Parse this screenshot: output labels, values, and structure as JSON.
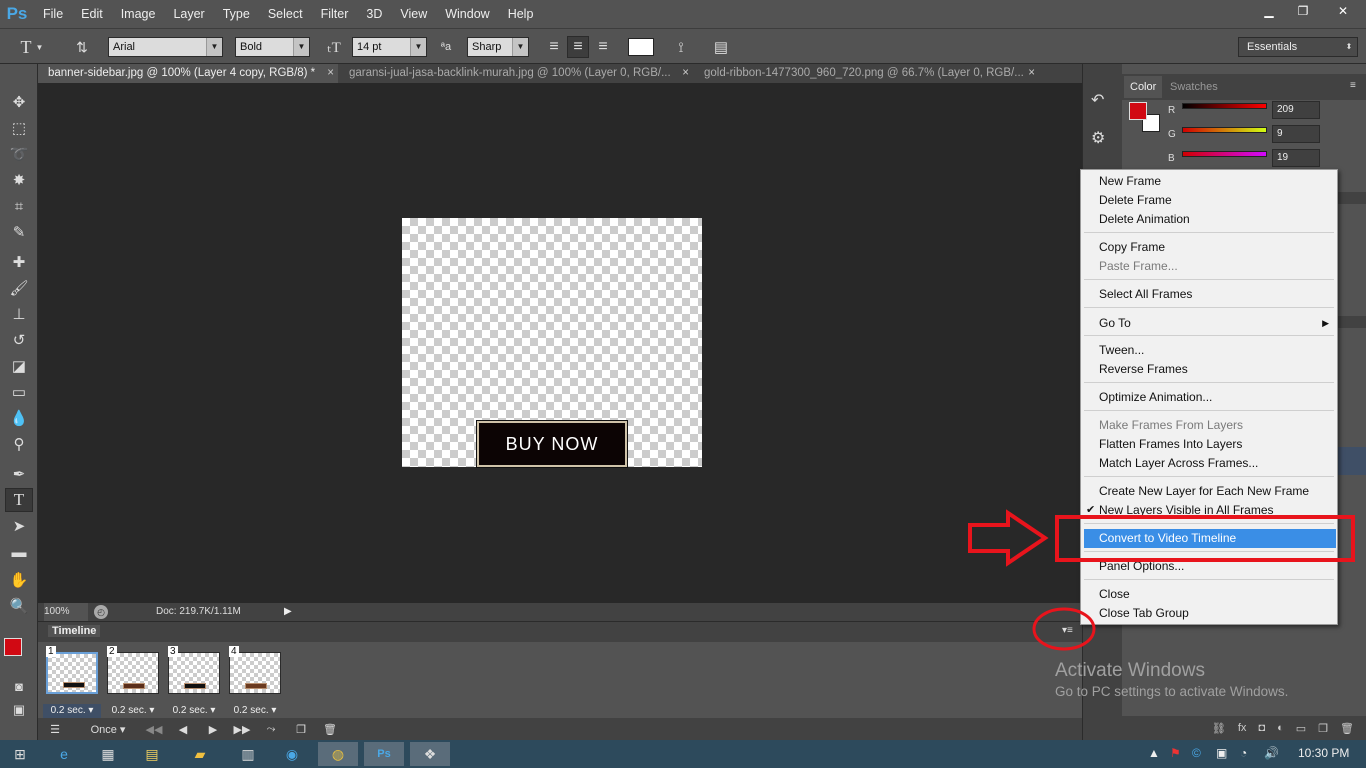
{
  "app": {
    "logo": "Ps"
  },
  "menubar": {
    "items": [
      "File",
      "Edit",
      "Image",
      "Layer",
      "Type",
      "Select",
      "Filter",
      "3D",
      "View",
      "Window",
      "Help"
    ]
  },
  "window_controls": {
    "minimize": "▁",
    "restore": "❐",
    "close": "✕"
  },
  "options_bar": {
    "font_family": "Arial",
    "font_style": "Bold",
    "font_size": "14 pt",
    "antialias": "Sharp",
    "workspace": "Essentials",
    "color_swatch": "#ffffff"
  },
  "document_tabs": [
    {
      "label": "banner-sidebar.jpg @ 100% (Layer 4 copy, RGB/8) *",
      "active": true
    },
    {
      "label": "garansi-jual-jasa-backlink-murah.jpg @ 100% (Layer 0, RGB/...",
      "active": false
    },
    {
      "label": "gold-ribbon-1477300_960_720.png @ 66.7% (Layer 0, RGB/...",
      "active": false
    }
  ],
  "canvas": {
    "button_text": "BUY NOW"
  },
  "status_bar": {
    "zoom": "100%",
    "doc_info": "Doc: 219.7K/1.11M"
  },
  "timeline": {
    "title": "Timeline",
    "frames": [
      {
        "number": "1",
        "duration": "0.2 sec.",
        "selected": true
      },
      {
        "number": "2",
        "duration": "0.2 sec.",
        "selected": false
      },
      {
        "number": "3",
        "duration": "0.2 sec.",
        "selected": false
      },
      {
        "number": "4",
        "duration": "0.2 sec.",
        "selected": false
      }
    ],
    "loop": "Once"
  },
  "color_panel": {
    "tabs": [
      "Color",
      "Swatches"
    ],
    "foreground": "#d10913",
    "background": "#ffffff",
    "r_label": "R",
    "r_value": "209",
    "g_label": "G",
    "g_value": "9",
    "b_label": "B",
    "b_value": "19"
  },
  "context_menu": {
    "items": [
      {
        "label": "New Frame"
      },
      {
        "label": "Delete Frame"
      },
      {
        "label": "Delete Animation"
      },
      {
        "label": "Copy Frame"
      },
      {
        "label": "Paste Frame..."
      },
      {
        "label": "Select All Frames"
      },
      {
        "label": "Go To"
      },
      {
        "label": "Tween..."
      },
      {
        "label": "Reverse Frames"
      },
      {
        "label": "Optimize Animation..."
      },
      {
        "label": "Make Frames From Layers"
      },
      {
        "label": "Flatten Frames Into Layers"
      },
      {
        "label": "Match Layer Across Frames..."
      },
      {
        "label": "Create New Layer for Each New Frame"
      },
      {
        "label": "New Layers Visible in All Frames"
      },
      {
        "label": "Convert to Video Timeline"
      },
      {
        "label": "Panel Options..."
      },
      {
        "label": "Close"
      },
      {
        "label": "Close Tab Group"
      }
    ]
  },
  "watermark": {
    "title": "Activate Windows",
    "subtitle": "Go to PC settings to activate Windows."
  },
  "annotation_color": "#e8141c",
  "taskbar": {
    "clock": "10:30 PM"
  }
}
